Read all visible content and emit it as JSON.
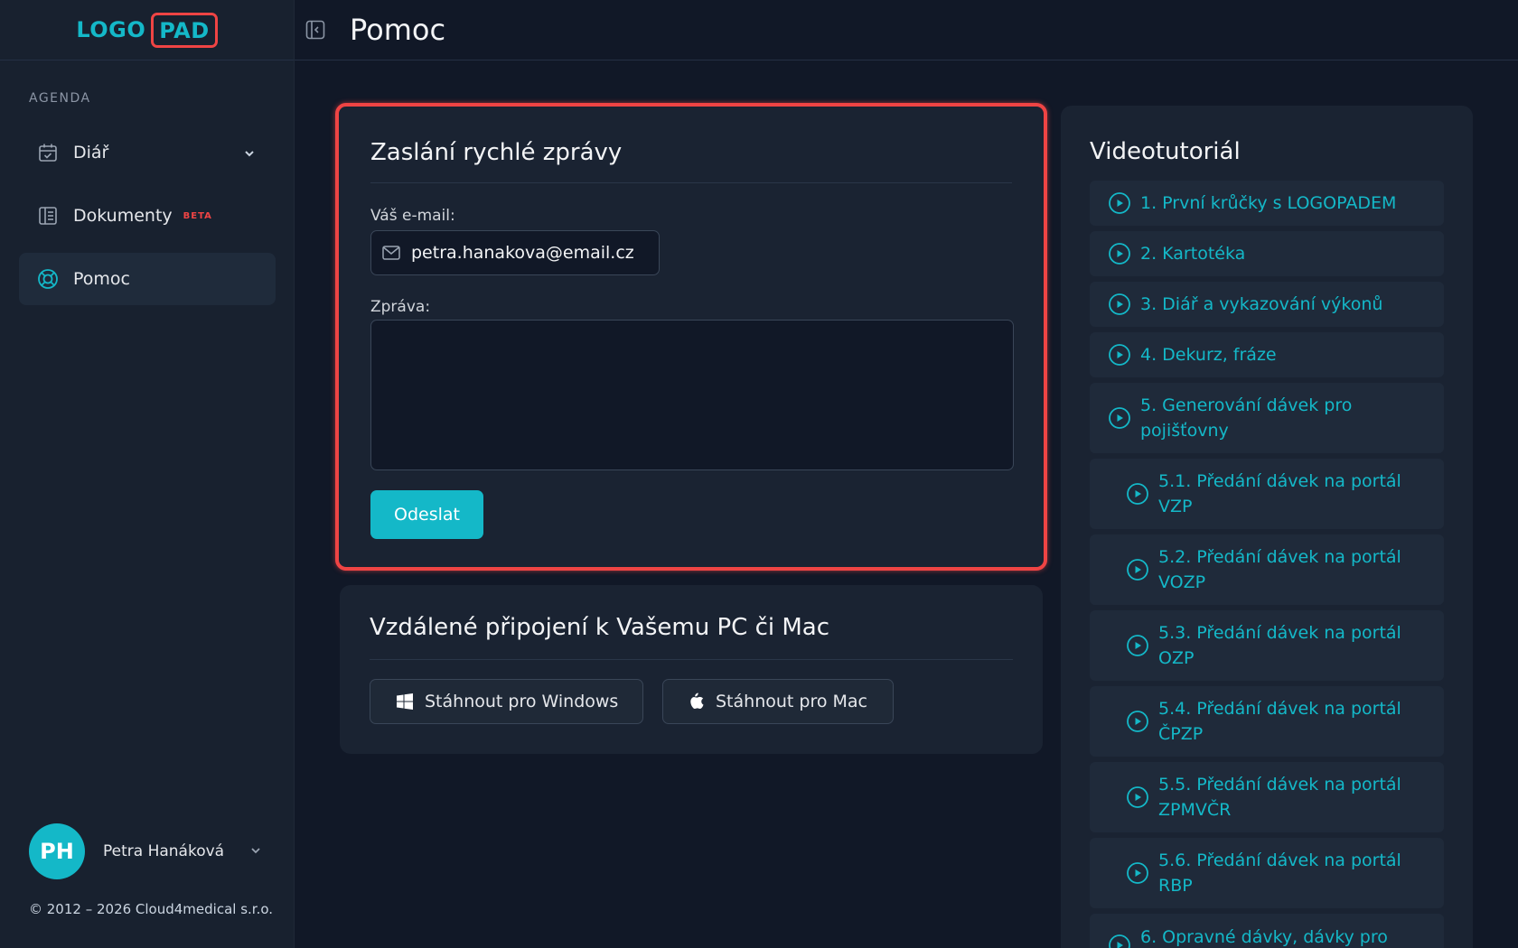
{
  "app": {
    "logo_left": "LOGO",
    "logo_right": "PAD",
    "page_title": "Pomoc"
  },
  "sidebar": {
    "section_label": "AGENDA",
    "items": [
      {
        "label": "Diář",
        "icon": "calendar-icon"
      },
      {
        "label": "Dokumenty",
        "icon": "document-icon",
        "badge": "BETA"
      },
      {
        "label": "Pomoc",
        "icon": "lifebuoy-icon",
        "active": true
      }
    ],
    "user": {
      "initials": "PH",
      "name": "Petra Hanáková"
    },
    "copyright": "© 2012 – 2026 Cloud4medical s.r.o."
  },
  "message_card": {
    "title": "Zaslání rychlé zprávy",
    "email_label": "Váš e-mail:",
    "email_value": "petra.hanakova@email.cz",
    "message_label": "Zpráva:",
    "message_value": "",
    "send_label": "Odeslat"
  },
  "remote_card": {
    "title": "Vzdálené připojení k Vašemu PC či Mac",
    "windows_label": "Stáhnout pro Windows",
    "mac_label": "Stáhnout pro Mac"
  },
  "video_card": {
    "title": "Videotutoriál",
    "items": [
      {
        "label": "1. První krůčky s LOGOPADEM"
      },
      {
        "label": "2. Kartotéka"
      },
      {
        "label": "3. Diář a vykazování výkonů"
      },
      {
        "label": "4. Dekurz, fráze"
      },
      {
        "label": "5. Generování dávek pro pojišťovny"
      },
      {
        "label": "5.1. Předání dávek na portál VZP"
      },
      {
        "label": "5.2. Předání dávek na portál VOZP"
      },
      {
        "label": "5.3. Předání dávek na portál OZP"
      },
      {
        "label": "5.4. Předání dávek na portál ČPZP"
      },
      {
        "label": "5.5. Předání dávek na portál ZPMVČR"
      },
      {
        "label": "5.6. Předání dávek na portál RBP"
      },
      {
        "label": "6. Opravné dávky, dávky pro"
      }
    ]
  },
  "colors": {
    "accent": "#14b8c8",
    "highlight": "#ef4444",
    "background": "#111827",
    "sidebar": "#18212f"
  }
}
